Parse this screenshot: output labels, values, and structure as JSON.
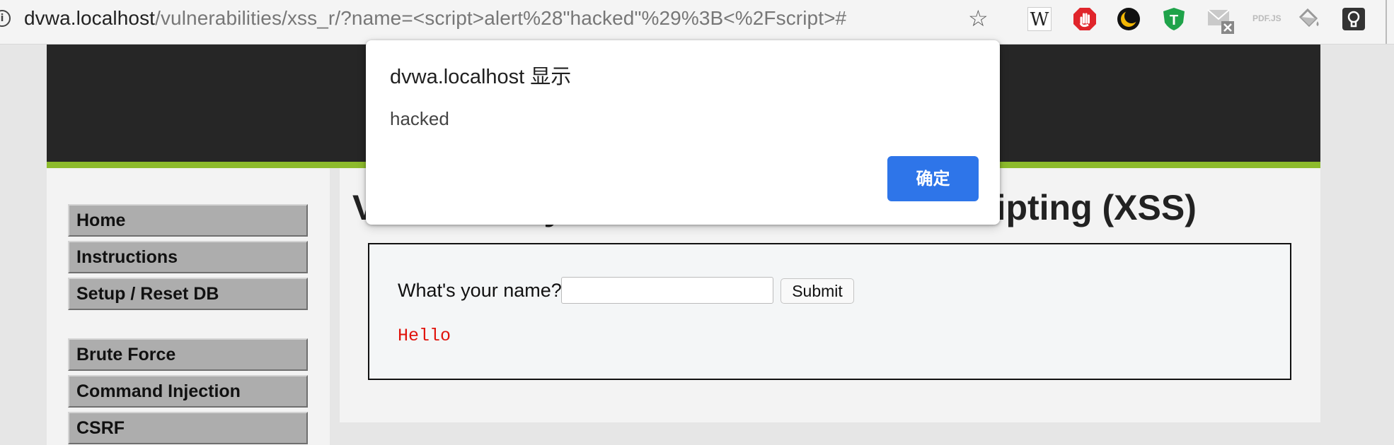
{
  "browser": {
    "url_host": "dvwa.localhost",
    "url_path": "/vulnerabilities/xss_r/?name=<script>alert%28\"hacked\"%29%3B<%2Fscript>#",
    "extensions": [
      {
        "icon": "wikipedia-w-icon",
        "label": "W"
      },
      {
        "icon": "adblock-stop-hand-icon"
      },
      {
        "icon": "dark-moon-icon"
      },
      {
        "icon": "green-t-shield-icon"
      },
      {
        "icon": "mail-muted-icon"
      },
      {
        "icon": "pdf-js-icon",
        "label": "PDF.JS"
      },
      {
        "icon": "paint-bucket-icon"
      },
      {
        "icon": "lightbulb-icon"
      }
    ]
  },
  "sidebar": {
    "items": [
      {
        "label": "Home"
      },
      {
        "label": "Instructions"
      },
      {
        "label": "Setup / Reset DB"
      },
      {
        "label": "Brute Force"
      },
      {
        "label": "Command Injection"
      },
      {
        "label": "CSRF"
      }
    ]
  },
  "main": {
    "title": "Vulnerability: Reflected Cross Site Scripting (XSS)",
    "form": {
      "label": "What's your name?",
      "input_value": "",
      "submit_label": "Submit"
    },
    "output": "Hello"
  },
  "dialog": {
    "title": "dvwa.localhost 显示",
    "message": "hacked",
    "ok_label": "确定",
    "ok_color": "#2e75e9"
  },
  "colors": {
    "header_bg": "#262626",
    "header_stripe": "#8dbb2c",
    "menu_bg": "#adadad",
    "hello_text": "#e0140d"
  }
}
